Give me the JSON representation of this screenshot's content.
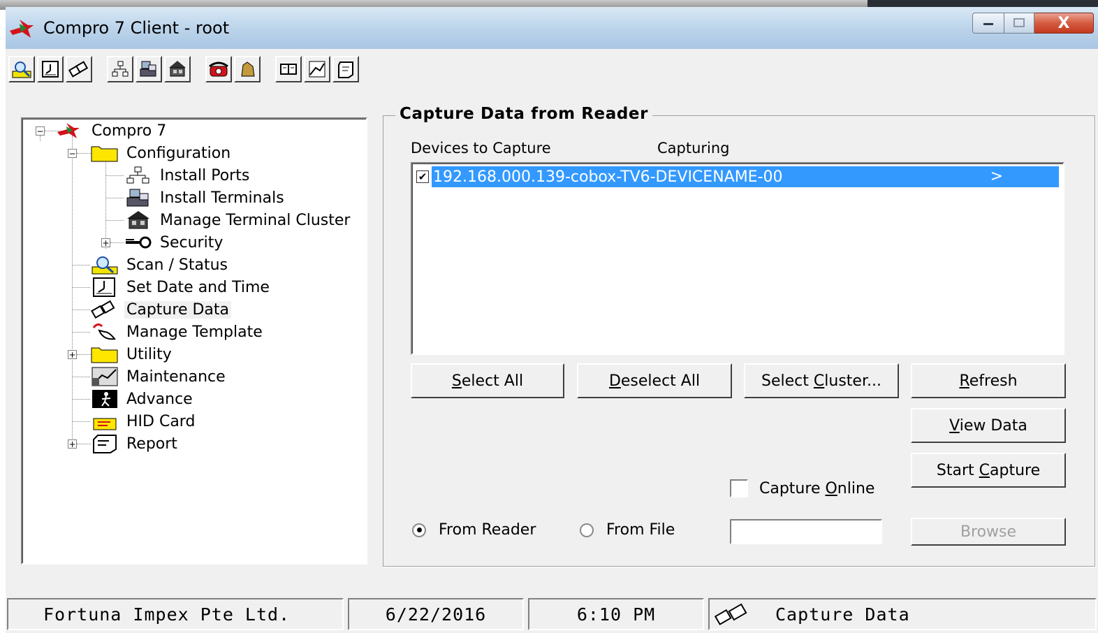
{
  "window": {
    "title": "Compro 7 Client - root",
    "close_glyph": "X"
  },
  "toolbar": {
    "groups": [
      [
        "scan-status-icon",
        "set-date-time-icon",
        "capture-data-icon"
      ],
      [
        "install-ports-icon",
        "install-terminals-icon",
        "manage-cluster-icon"
      ],
      [
        "phone-icon",
        "maintenance-hand-icon"
      ],
      [
        "book-icon",
        "maintenance-icon",
        "report-icon"
      ]
    ]
  },
  "tree": {
    "root": "Compro 7",
    "configuration": "Configuration",
    "install_ports": "Install Ports",
    "install_terminals": "Install Terminals",
    "manage_terminal_cluster": "Manage Terminal Cluster",
    "security": "Security",
    "scan_status": "Scan / Status",
    "set_date_time": "Set Date and Time",
    "capture_data": "Capture Data",
    "manage_template": "Manage Template",
    "utility": "Utility",
    "maintenance": "Maintenance",
    "advance": "Advance",
    "hid_card": "HID Card",
    "report": "Report",
    "expand_glyph": "+",
    "collapse_glyph": "−"
  },
  "capture": {
    "group_title": "Capture Data from Reader",
    "col_devices": "Devices to Capture",
    "col_capturing": "Capturing",
    "devices": [
      {
        "name": "192.168.000.139-cobox-TV6-DEVICENAME-00",
        "checked": "✔",
        "capturing": ">"
      }
    ],
    "buttons": {
      "select_all_u": "S",
      "select_all_rest": "elect All",
      "deselect_all_u": "D",
      "deselect_all_rest": "eselect All",
      "select_cluster_pre": "Select ",
      "select_cluster_u": "C",
      "select_cluster_rest": "luster...",
      "refresh_u": "R",
      "refresh_rest": "efresh",
      "view_data_u": "V",
      "view_data_rest": "iew Data",
      "start_capture_pre": "Start ",
      "start_capture_u": "C",
      "start_capture_rest": "apture",
      "browse": "Browse"
    },
    "capture_online_pre": "Capture ",
    "capture_online_u": "O",
    "capture_online_rest": "nline",
    "from_reader": "From Reader",
    "from_file": "From File",
    "file_path_value": ""
  },
  "status": {
    "company": "Fortuna Impex Pte Ltd.",
    "date": "6/22/2016",
    "time": "6:10 PM",
    "module": "Capture Data"
  }
}
